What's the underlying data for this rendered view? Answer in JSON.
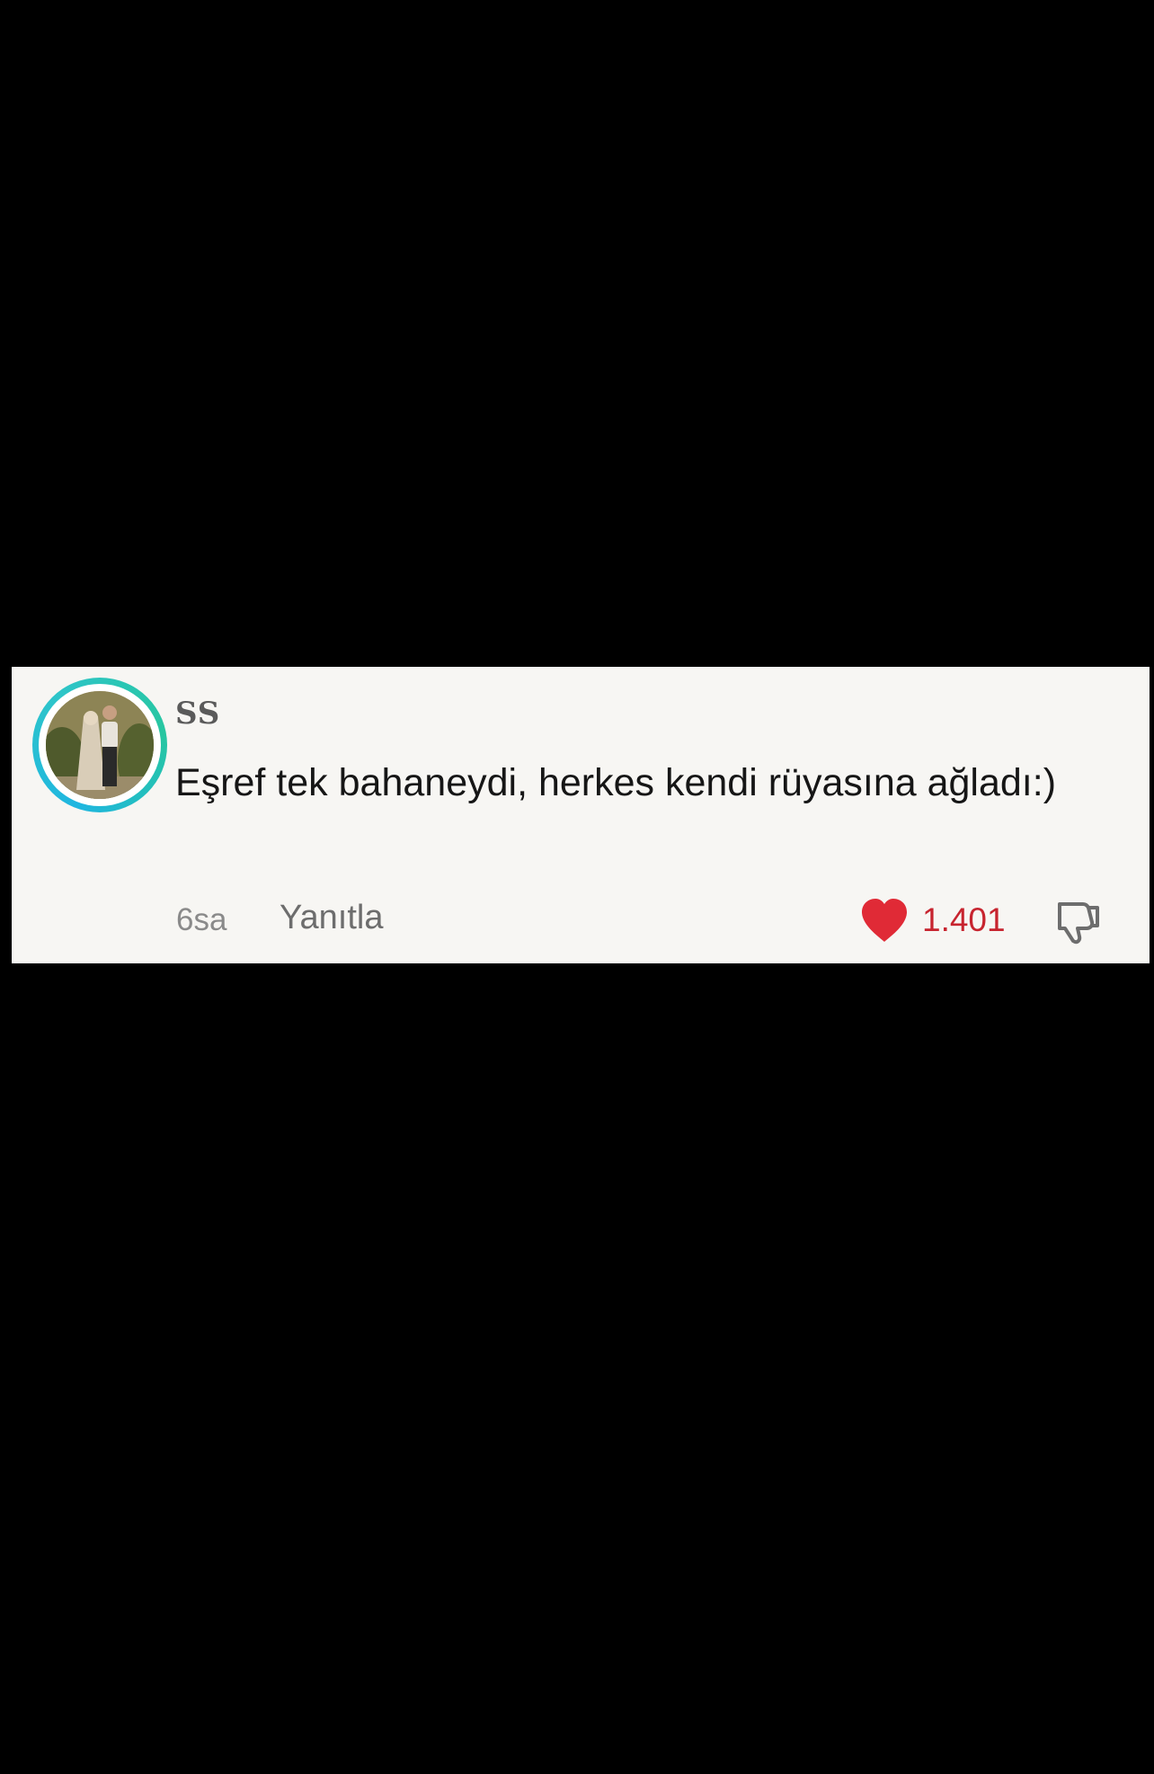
{
  "comment": {
    "username": "SS",
    "text": "Eşref tek bahaneydi, herkes kendi rüyasına ağladı:)",
    "time": "6sa",
    "reply_label": "Yanıtla",
    "like_count": "1.401",
    "liked": true
  },
  "colors": {
    "background": "#000000",
    "card": "#f7f6f3",
    "like_red": "#e02a36",
    "avatar_ring": "#1fb6e0"
  },
  "icons": {
    "like": "heart-icon",
    "dislike": "thumbs-down-icon"
  }
}
